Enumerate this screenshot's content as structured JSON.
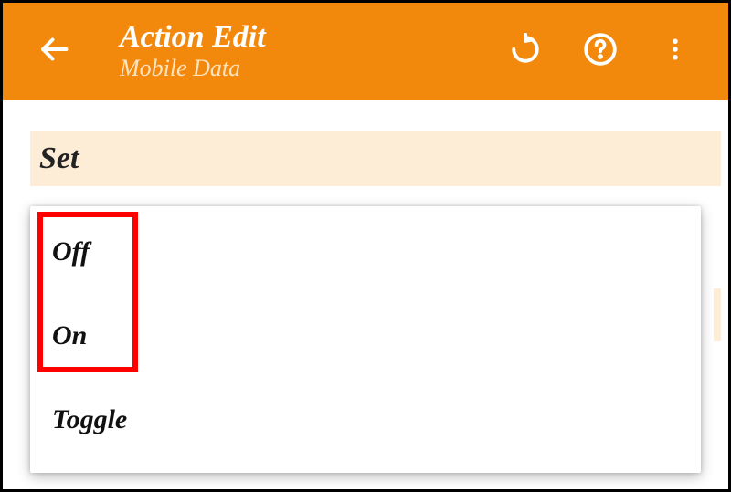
{
  "appbar": {
    "title": "Action Edit",
    "subtitle": "Mobile Data"
  },
  "section": {
    "label": "Set"
  },
  "options": {
    "0": "Off",
    "1": "On",
    "2": "Toggle"
  },
  "icons": {
    "back": "back-arrow",
    "undo": "undo",
    "help": "help-circle",
    "overflow": "more-vert"
  }
}
